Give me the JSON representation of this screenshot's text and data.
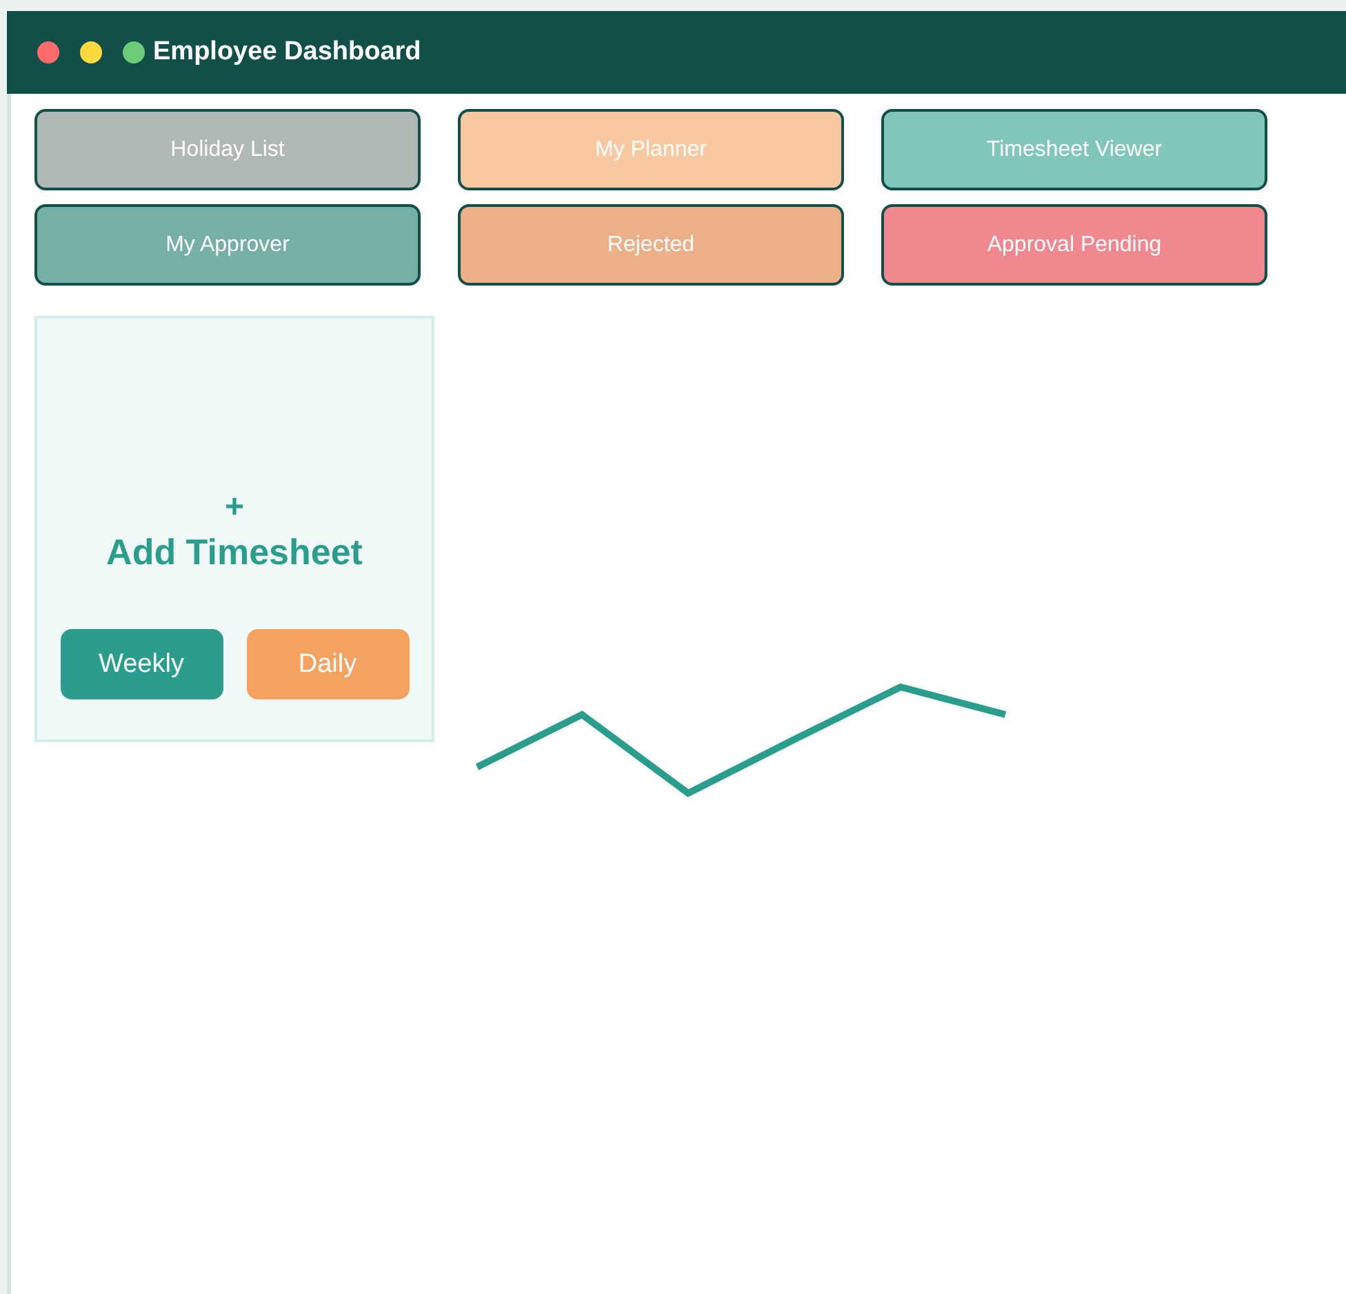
{
  "window": {
    "title": "Employee Dashboard"
  },
  "tiles": [
    {
      "label": "Holiday List",
      "color": "#b0b8b6"
    },
    {
      "label": "My Planner",
      "color": "#f8c9a0"
    },
    {
      "label": "Timesheet Viewer",
      "color": "#80c6ba"
    },
    {
      "label": "My Approver",
      "color": "#76afa6"
    },
    {
      "label": "Rejected",
      "color": "#ebb088"
    },
    {
      "label": "Approval Pending",
      "color": "#f08890"
    }
  ],
  "add_card": {
    "icon": "+",
    "title": "Add Timesheet",
    "buttons": [
      {
        "label": "Weekly",
        "color": "#2b9d8c"
      },
      {
        "label": "Daily",
        "color": "#f3a262"
      }
    ]
  }
}
